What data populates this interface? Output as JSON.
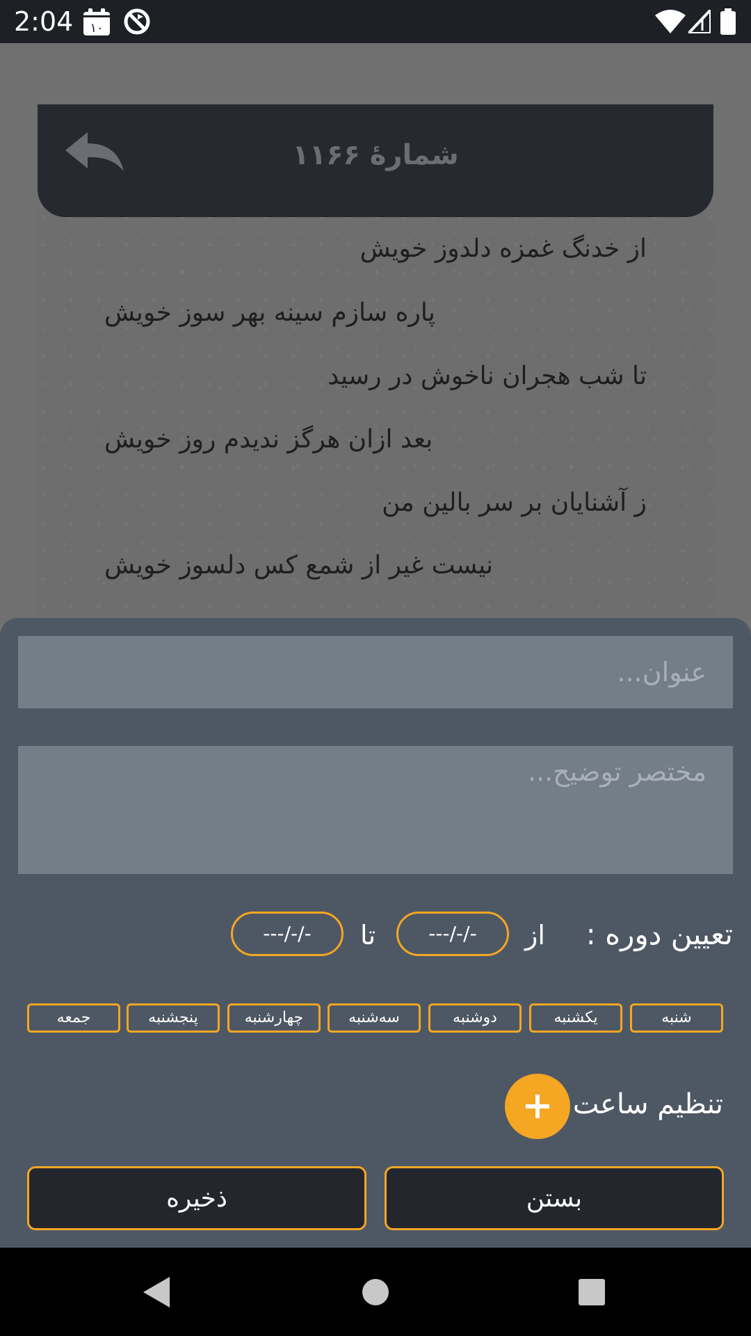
{
  "status_bar": {
    "time": "2:04",
    "calendar_day": "۱۰",
    "icons": [
      "calendar-icon",
      "sync-disabled-icon",
      "wifi-icon",
      "signal-icon",
      "battery-icon"
    ]
  },
  "reader": {
    "title": "شمارهٔ ۱۱۶۶",
    "poem_lines": [
      "از خدنگ غمزه دلدوز خویش",
      "پاره سازم سینه بهر سوز خویش",
      "تا شب هجران ناخوش در رسید",
      "بعد ازان هرگز ندیدم روز خویش",
      "ز آشنایان بر سر بالین من",
      "نیست غیر از شمع کس دلسوز خویش"
    ]
  },
  "form": {
    "title_placeholder": "عنوان...",
    "description_placeholder": "مختصر توضیح...",
    "period_label": "تعیین دوره :",
    "from_label": "از",
    "to_label": "تا",
    "from_date": "---/-/-",
    "to_date": "---/-/-",
    "days": [
      "شنبه",
      "یکشنبه",
      "دوشنبه",
      "سه‌شنبه",
      "چهارشنبه",
      "پنجشنبه",
      "جمعه"
    ],
    "time_label": "تنظیم ساعت :",
    "close_label": "بستن",
    "save_label": "ذخیره"
  },
  "colors": {
    "accent": "#f5a623",
    "sheet": "#4e5864",
    "field": "#747e88",
    "header": "#262a30"
  }
}
